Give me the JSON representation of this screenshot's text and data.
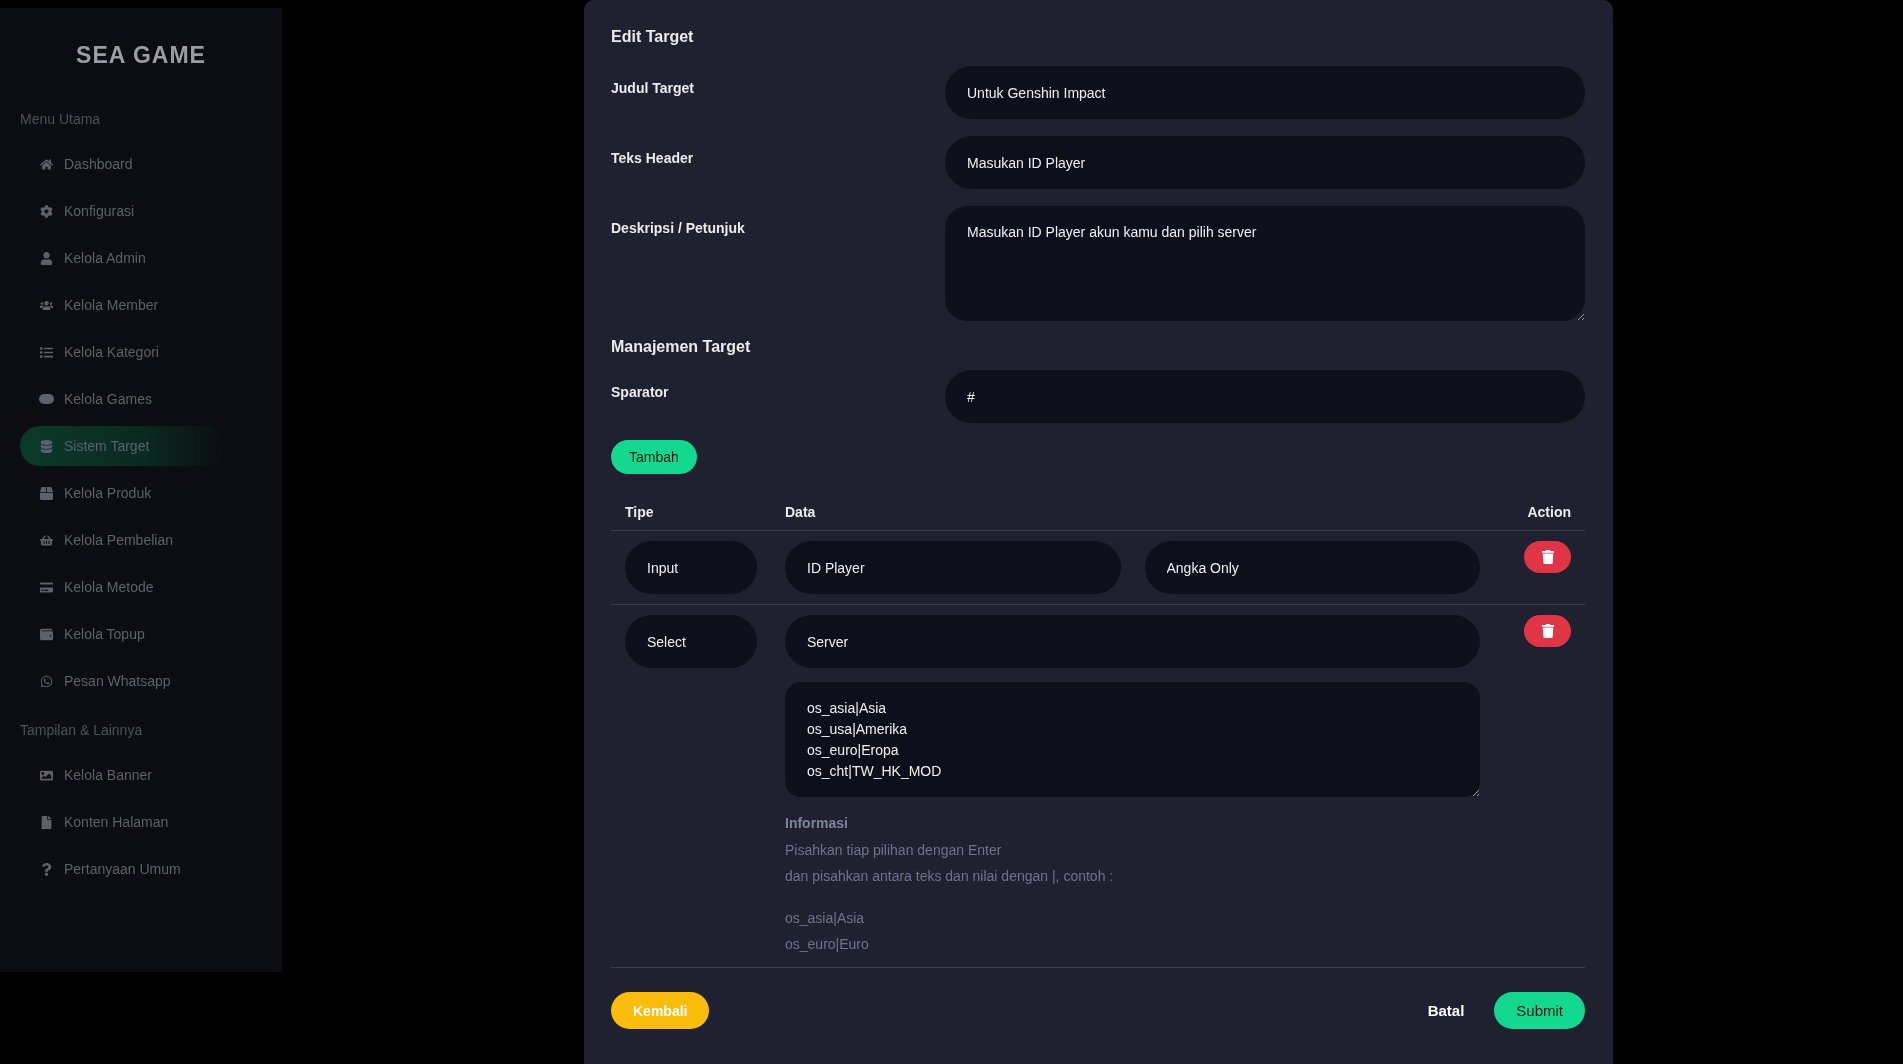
{
  "sidebar": {
    "logo": "SEA GAME",
    "sections": [
      {
        "title": "Menu Utama",
        "items": [
          {
            "label": "Dashboard",
            "selected": false
          },
          {
            "label": "Konfigurasi",
            "selected": false
          },
          {
            "label": "Kelola Admin",
            "selected": false
          },
          {
            "label": "Kelola Member",
            "selected": false
          },
          {
            "label": "Kelola Kategori",
            "selected": false
          },
          {
            "label": "Kelola Games",
            "selected": false
          },
          {
            "label": "Sistem Target",
            "selected": true
          },
          {
            "label": "Kelola Produk",
            "selected": false
          },
          {
            "label": "Kelola Pembelian",
            "selected": false
          },
          {
            "label": "Kelola Metode",
            "selected": false
          },
          {
            "label": "Kelola Topup",
            "selected": false
          },
          {
            "label": "Pesan Whatsapp",
            "selected": false
          }
        ]
      },
      {
        "title": "Tampilan & Lainnya",
        "items": [
          {
            "label": "Kelola Banner",
            "selected": false
          },
          {
            "label": "Konten Halaman",
            "selected": false
          },
          {
            "label": "Pertanyaan Umum",
            "selected": false
          }
        ]
      }
    ]
  },
  "modal": {
    "title": "Edit Target",
    "fields": [
      {
        "label": "Judul Target",
        "value": "Untuk Genshin Impact",
        "kind": "input"
      },
      {
        "label": "Teks Header",
        "value": "Masukan ID Player",
        "kind": "input"
      },
      {
        "label": "Deskripsi / Petunjuk",
        "value": "Masukan ID Player akun kamu dan pilih server",
        "kind": "textarea"
      }
    ],
    "section_title": "Manajemen Target",
    "separator": {
      "label": "Sparator",
      "value": "#"
    },
    "add_button": "Tambah",
    "table": {
      "columns": [
        "Tipe",
        "Data",
        "Action"
      ],
      "rows": [
        {
          "kind": "input",
          "type": "Input",
          "data": [
            "ID Player",
            "Angka Only"
          ]
        },
        {
          "kind": "select",
          "type": "Select",
          "data": [
            "Server"
          ],
          "options": "os_asia|Asia\nos_usa|Amerika\nos_euro|Eropa\nos_cht|TW_HK_MOD",
          "info": {
            "title": "Informasi",
            "lines": [
              "Pisahkan tiap pilihan dengan Enter",
              "dan pisahkan antara teks dan nilai dengan |, contoh :"
            ],
            "examples": [
              "os_asia|Asia",
              "os_euro|Euro"
            ]
          }
        }
      ]
    },
    "back_button": "Kembali",
    "cancel_button": "Batal",
    "submit_button": "Submit"
  }
}
